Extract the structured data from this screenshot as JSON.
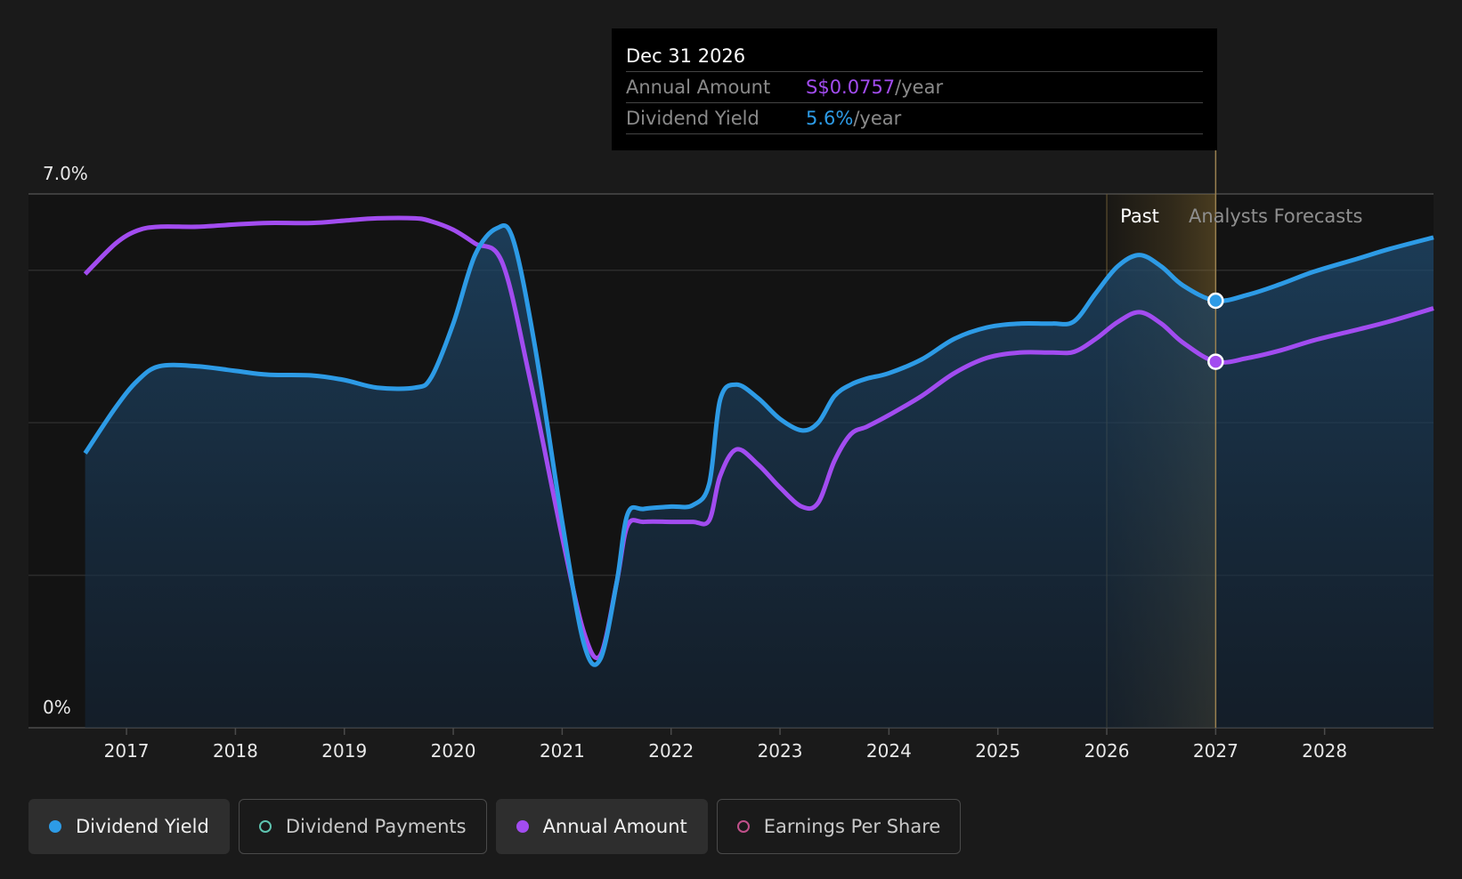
{
  "colors": {
    "yield": "#2d9be6",
    "annual": "#a24cf0",
    "payments": "#5ec4b0",
    "eps": "#c0508a",
    "past_band": "#8a6d2f"
  },
  "tooltip": {
    "date": "Dec 31 2026",
    "rows": [
      {
        "label": "Annual Amount",
        "value": "S$0.0757",
        "unit": "/year",
        "color": "#a24cf0"
      },
      {
        "label": "Dividend Yield",
        "value": "5.6%",
        "unit": "/year",
        "color": "#2d9be6"
      }
    ]
  },
  "region_labels": {
    "past": "Past",
    "forecast": "Analysts Forecasts"
  },
  "legend": [
    {
      "label": "Dividend Yield",
      "icon": "filled-circle-icon",
      "active": true
    },
    {
      "label": "Dividend Payments",
      "icon": "hollow-circle-icon",
      "active": false
    },
    {
      "label": "Annual Amount",
      "icon": "filled-circle-icon",
      "active": true
    },
    {
      "label": "Earnings Per Share",
      "icon": "hollow-circle-icon",
      "active": false
    }
  ],
  "chart_data": {
    "type": "area",
    "title": "",
    "xlabel": "",
    "ylabel": "",
    "y_tick_labels": [
      "7.0%",
      "0%"
    ],
    "ylim": [
      0,
      7.0
    ],
    "xlim": [
      2016.1,
      2029.0
    ],
    "x_ticks": [
      2017,
      2018,
      2019,
      2020,
      2021,
      2022,
      2023,
      2024,
      2025,
      2026,
      2027,
      2028
    ],
    "grid": true,
    "past_band": [
      2026.0,
      2027.0
    ],
    "highlight_x": 2027.0,
    "series": [
      {
        "name": "Dividend Yield",
        "x": [
          2016.62,
          2016.9,
          2017.1,
          2017.3,
          2017.65,
          2018.0,
          2018.3,
          2018.7,
          2019.0,
          2019.3,
          2019.65,
          2019.8,
          2020.0,
          2020.2,
          2020.4,
          2020.55,
          2020.75,
          2021.0,
          2021.2,
          2021.35,
          2021.5,
          2021.6,
          2021.75,
          2022.0,
          2022.2,
          2022.35,
          2022.45,
          2022.6,
          2022.8,
          2023.0,
          2023.2,
          2023.35,
          2023.5,
          2023.65,
          2023.8,
          2024.0,
          2024.3,
          2024.6,
          2024.9,
          2025.2,
          2025.5,
          2025.7,
          2025.9,
          2026.1,
          2026.3,
          2026.5,
          2026.7,
          2027.0,
          2027.3,
          2027.6,
          2027.9,
          2028.3,
          2028.6,
          2029.0
        ],
        "values": [
          3.6,
          4.2,
          4.55,
          4.74,
          4.74,
          4.68,
          4.63,
          4.62,
          4.56,
          4.46,
          4.46,
          4.6,
          5.3,
          6.2,
          6.55,
          6.4,
          5.0,
          2.7,
          1.1,
          0.9,
          1.9,
          2.8,
          2.87,
          2.9,
          2.92,
          3.2,
          4.3,
          4.5,
          4.32,
          4.05,
          3.9,
          4.0,
          4.35,
          4.5,
          4.58,
          4.65,
          4.83,
          5.1,
          5.25,
          5.3,
          5.3,
          5.33,
          5.7,
          6.05,
          6.2,
          6.05,
          5.8,
          5.6,
          5.68,
          5.82,
          5.98,
          6.15,
          6.28,
          6.43
        ]
      },
      {
        "name": "Annual Amount",
        "x": [
          2016.62,
          2016.9,
          2017.1,
          2017.3,
          2017.65,
          2018.0,
          2018.3,
          2018.7,
          2019.0,
          2019.3,
          2019.65,
          2019.8,
          2020.0,
          2020.2,
          2020.45,
          2020.7,
          2021.0,
          2021.2,
          2021.35,
          2021.5,
          2021.6,
          2021.75,
          2022.0,
          2022.2,
          2022.35,
          2022.45,
          2022.6,
          2022.8,
          2023.0,
          2023.2,
          2023.35,
          2023.5,
          2023.65,
          2023.8,
          2024.0,
          2024.3,
          2024.6,
          2024.9,
          2025.2,
          2025.5,
          2025.7,
          2025.9,
          2026.1,
          2026.3,
          2026.5,
          2026.7,
          2027.0,
          2027.3,
          2027.6,
          2027.9,
          2028.3,
          2028.6,
          2029.0
        ],
        "values": [
          5.95,
          6.35,
          6.52,
          6.57,
          6.57,
          6.6,
          6.62,
          6.62,
          6.65,
          6.68,
          6.68,
          6.64,
          6.53,
          6.35,
          6.1,
          4.6,
          2.5,
          1.25,
          0.95,
          1.9,
          2.65,
          2.7,
          2.7,
          2.7,
          2.72,
          3.3,
          3.65,
          3.45,
          3.15,
          2.9,
          2.95,
          3.5,
          3.85,
          3.95,
          4.1,
          4.35,
          4.65,
          4.85,
          4.92,
          4.92,
          4.93,
          5.1,
          5.32,
          5.45,
          5.3,
          5.05,
          4.8,
          4.85,
          4.95,
          5.08,
          5.22,
          5.33,
          5.5
        ]
      }
    ]
  }
}
